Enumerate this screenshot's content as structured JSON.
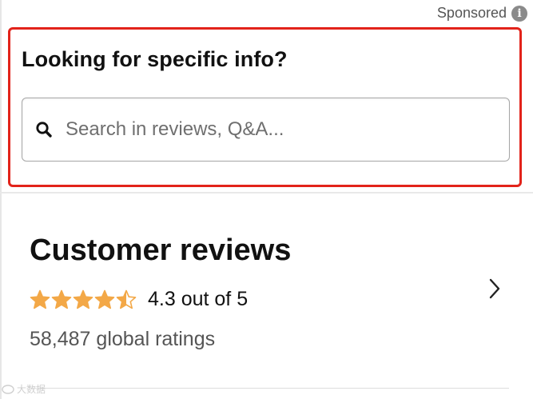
{
  "sponsored": {
    "label": "Sponsored",
    "info_glyph": "i"
  },
  "search_section": {
    "heading": "Looking for specific info?",
    "placeholder": "Search in reviews, Q&A...",
    "value": ""
  },
  "reviews": {
    "title": "Customer reviews",
    "rating_value": 4.3,
    "rating_text": "4.3 out of 5",
    "star_fill": [
      1,
      1,
      1,
      1,
      0.5
    ],
    "global_ratings": "58,487 global ratings"
  },
  "watermark": {
    "text": "大数据"
  },
  "colors": {
    "star": "#f3a847",
    "highlight_border": "#e2231a"
  }
}
